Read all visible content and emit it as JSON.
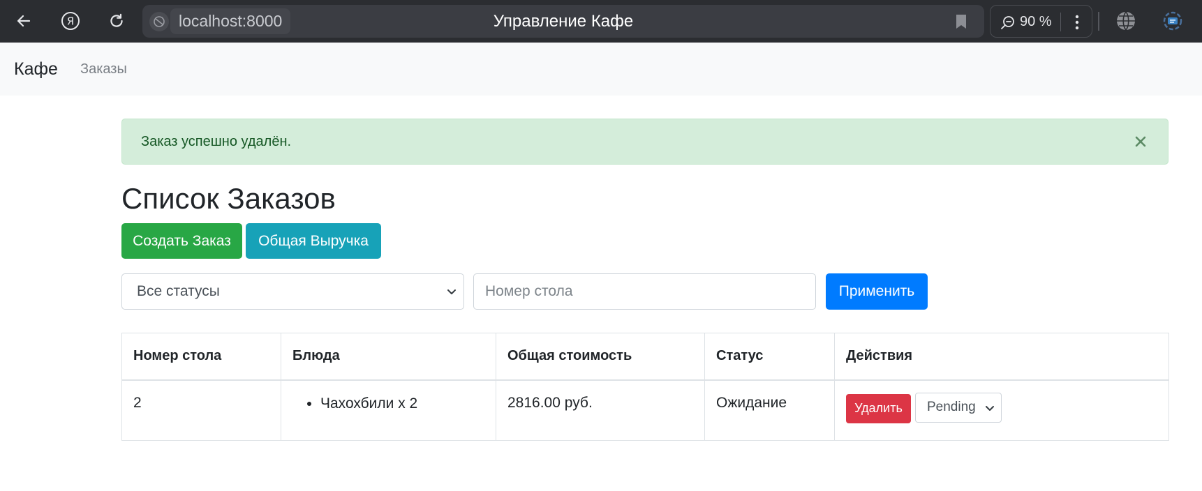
{
  "browser": {
    "url": "localhost:8000",
    "tab_title": "Управление Кафе",
    "zoom": "90 %"
  },
  "navbar": {
    "brand": "Кафе",
    "link_orders": "Заказы"
  },
  "alert": {
    "message": "Заказ успешно удалён.",
    "close_symbol": "×"
  },
  "page": {
    "title": "Список Заказов",
    "create_button": "Создать Заказ",
    "revenue_button": "Общая Выручка"
  },
  "filters": {
    "status_selected": "Все статусы",
    "table_placeholder": "Номер стола",
    "apply_button": "Применить"
  },
  "table": {
    "headers": [
      "Номер стола",
      "Блюда",
      "Общая стоимость",
      "Статус",
      "Действия"
    ],
    "rows": [
      {
        "table_number": "2",
        "dishes": [
          "Чахохбили x 2"
        ],
        "total": "2816.00 руб.",
        "status": "Ожидание",
        "delete_button": "Удалить",
        "status_select": "Pending"
      }
    ]
  },
  "colors": {
    "success": "#28a745",
    "info": "#17a2b8",
    "primary": "#007bff",
    "danger": "#dc3545",
    "alert_bg": "#d4edda"
  }
}
